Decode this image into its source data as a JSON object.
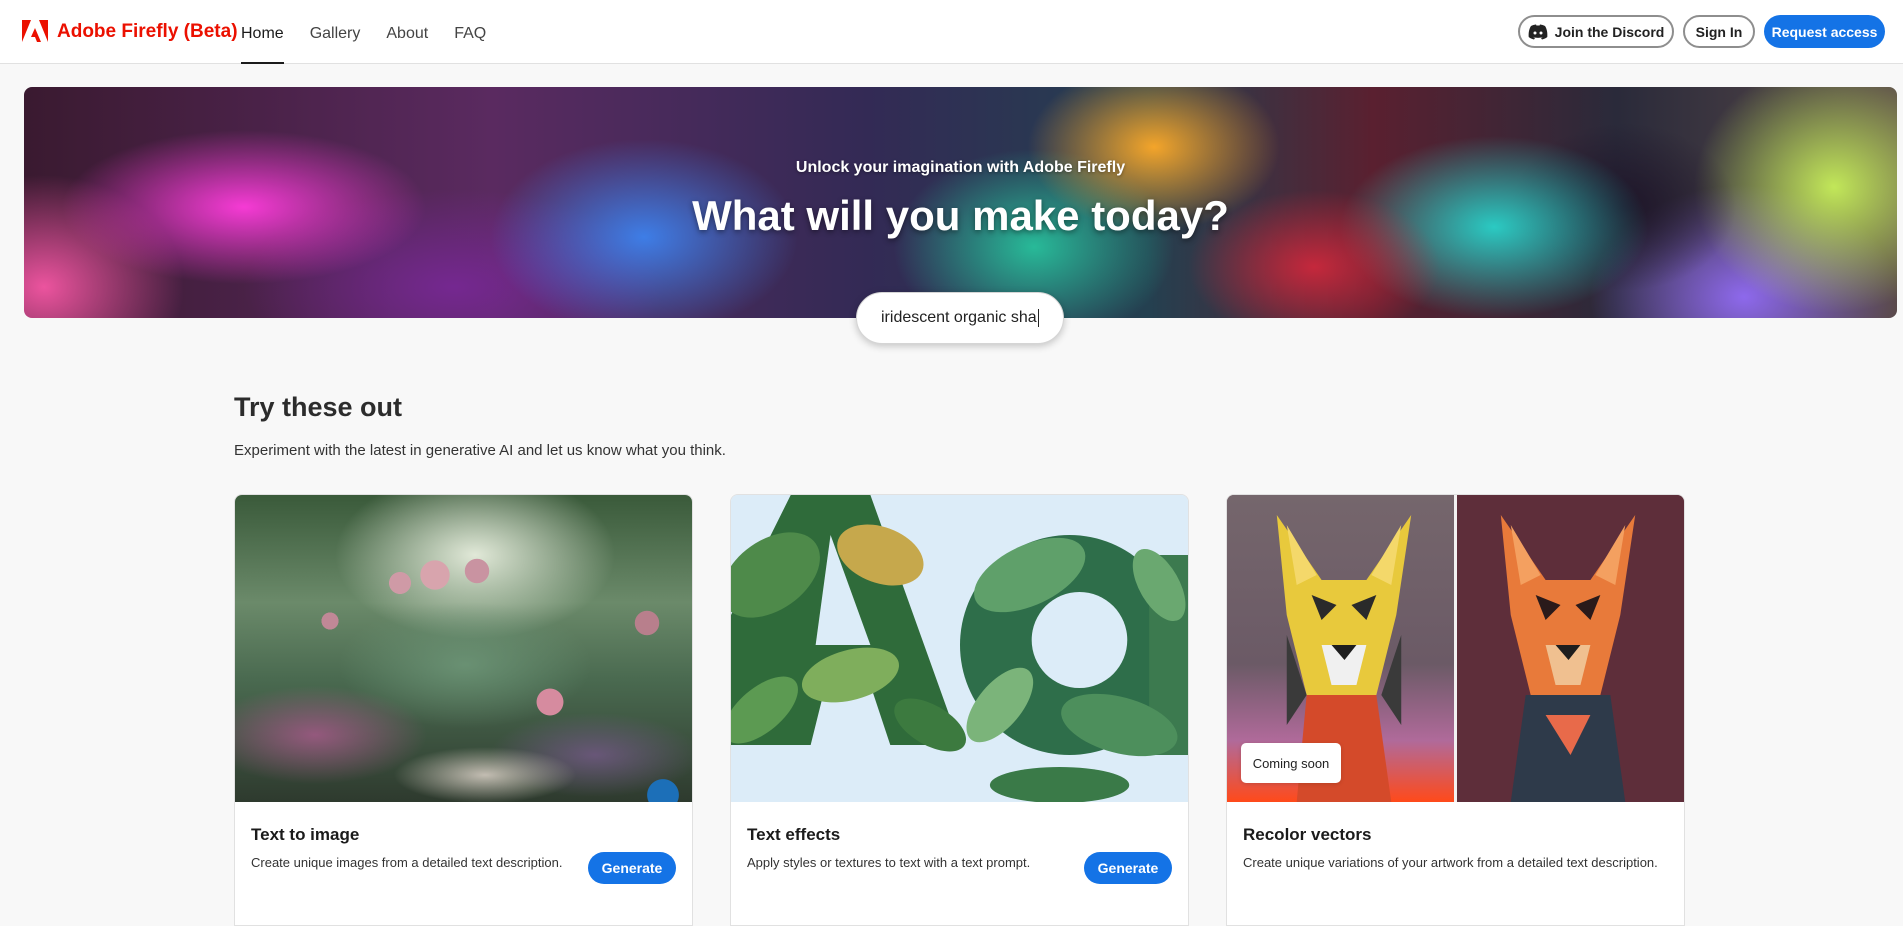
{
  "header": {
    "brand": "Adobe Firefly (Beta)",
    "nav": [
      {
        "label": "Home",
        "active": true
      },
      {
        "label": "Gallery",
        "active": false
      },
      {
        "label": "About",
        "active": false
      },
      {
        "label": "FAQ",
        "active": false
      }
    ],
    "discord_label": "Join the Discord",
    "signin_label": "Sign In",
    "request_label": "Request access"
  },
  "hero": {
    "subtitle": "Unlock your imagination with Adobe Firefly",
    "title": "What will you make today?",
    "prompt_value": "iridescent organic sha"
  },
  "section": {
    "title": "Try these out",
    "description": "Experiment with the latest in generative AI and let us know what you think."
  },
  "cards": [
    {
      "title": "Text to image",
      "description": "Create unique images from a detailed text description.",
      "button": "Generate",
      "image": "fantasy-garden"
    },
    {
      "title": "Text effects",
      "description": "Apply styles or textures to text with a text prompt.",
      "button": "Generate",
      "image": "leaf-letters-Aa"
    },
    {
      "title": "Recolor vectors",
      "description": "Create unique variations of your artwork from a detailed text description.",
      "badge": "Coming soon",
      "image": "geometric-dogs"
    }
  ],
  "colors": {
    "brand": "#eb1000",
    "accent": "#1473e6"
  },
  "icons": [
    "adobe-logo-icon",
    "discord-icon"
  ]
}
